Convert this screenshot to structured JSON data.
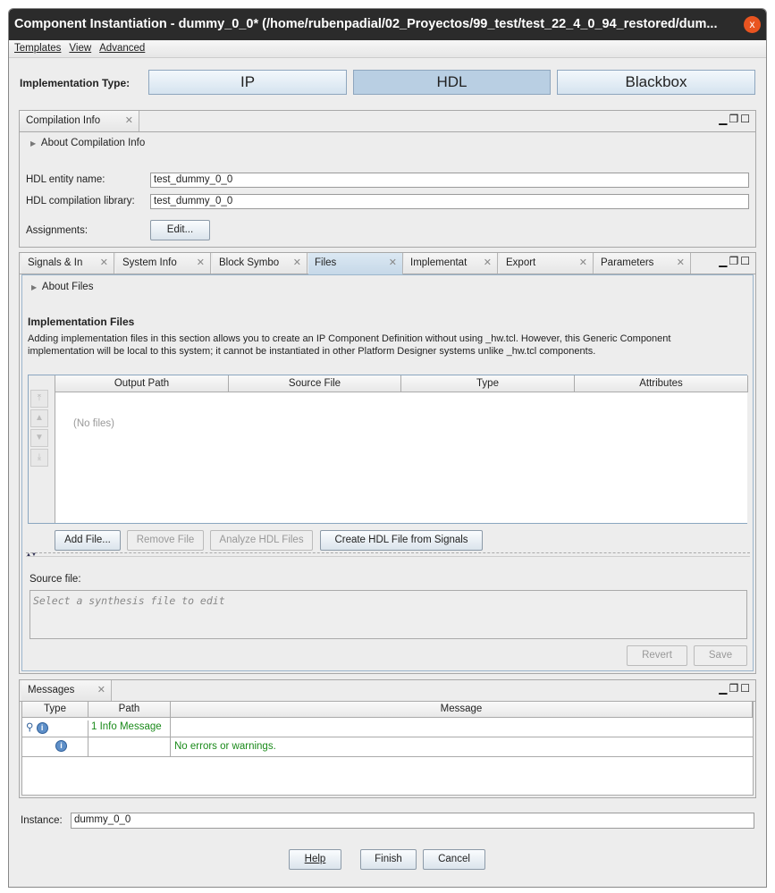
{
  "window": {
    "title": "Component Instantiation - dummy_0_0* (/home/rubenpadial/02_Proyectos/99_test/test_22_4_0_94_restored/dum...",
    "close": "x"
  },
  "menu": [
    "Templates",
    "View",
    "Advanced"
  ],
  "impl_type": {
    "label": "Implementation Type:",
    "options": [
      "IP",
      "HDL",
      "Blackbox"
    ],
    "selected": "HDL"
  },
  "compilation": {
    "tab": "Compilation Info",
    "about": "About Compilation Info",
    "entity_label": "HDL entity name:",
    "entity_value": "test_dummy_0_0",
    "library_label": "HDL compilation library:",
    "library_value": "test_dummy_0_0",
    "assign_label": "Assignments:",
    "edit_button": "Edit..."
  },
  "tabs": [
    "Signals & In",
    "System Info",
    "Block Symbo",
    "Files",
    "Implementat",
    "Export",
    "Parameters"
  ],
  "files": {
    "about": "About Files",
    "heading": "Implementation Files",
    "description": "Adding implementation files in this section allows you to create an IP Component Definition without using _hw.tcl. However, this Generic Component implementation will be local to this system; it cannot be instantiated in other Platform Designer systems unlike _hw.tcl components.",
    "columns": [
      "Output Path",
      "Source File",
      "Type",
      "Attributes"
    ],
    "empty": "(No files)",
    "buttons": [
      "Add File...",
      "Remove File",
      "Analyze HDL Files",
      "Create HDL File from Signals"
    ],
    "source_label": "Source file:",
    "source_placeholder": "Select a synthesis file to edit",
    "revert": "Revert",
    "save": "Save"
  },
  "messages": {
    "tab": "Messages",
    "columns": [
      "Type",
      "Path",
      "Message"
    ],
    "rows": [
      {
        "path": "1 Info Message",
        "message": ""
      },
      {
        "path": "",
        "message": "No errors or warnings."
      }
    ]
  },
  "instance": {
    "label": "Instance:",
    "value": "dummy_0_0"
  },
  "footer": {
    "help": "Help",
    "finish": "Finish",
    "cancel": "Cancel"
  }
}
